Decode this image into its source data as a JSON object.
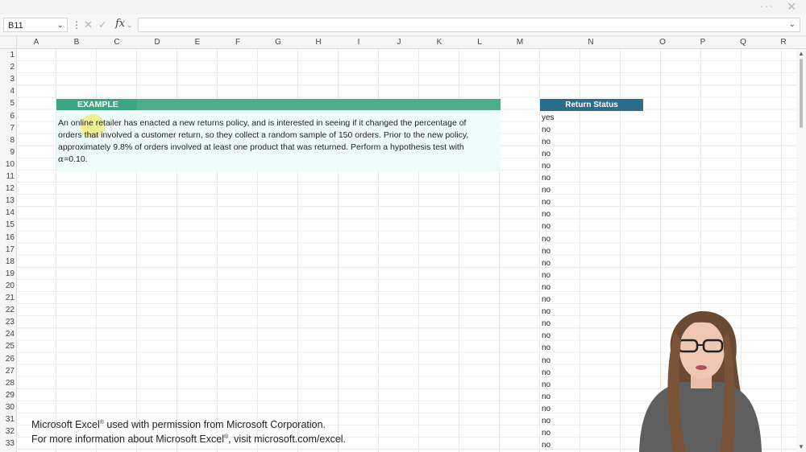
{
  "window": {
    "more_icon": "more-icon",
    "close_icon": "close-icon"
  },
  "formula_bar": {
    "name_box": "B11",
    "fx_label": "fx",
    "formula_value": ""
  },
  "columns": [
    "A",
    "B",
    "C",
    "D",
    "E",
    "F",
    "G",
    "H",
    "I",
    "J",
    "K",
    "L",
    "M",
    "N",
    "O",
    "P",
    "Q",
    "R"
  ],
  "rows": [
    "1",
    "2",
    "3",
    "4",
    "5",
    "6",
    "7",
    "8",
    "9",
    "10",
    "11",
    "12",
    "13",
    "14",
    "15",
    "16",
    "17",
    "18",
    "19",
    "20",
    "21",
    "22",
    "23",
    "24",
    "25",
    "26",
    "27",
    "28",
    "29",
    "30",
    "31",
    "32",
    "33"
  ],
  "example": {
    "title": "EXAMPLE",
    "line1": "An online retailer has enacted a new returns policy, and is interested in seeing if it changed the percentage of",
    "line2": "orders that involved a customer return, so they collect a random sample of 150 orders. Prior to the new policy,",
    "line3": "approximately 9.8% of orders involved at least one product that was returned. Perform a hypothesis test with",
    "alpha_symbol": "α",
    "alpha_value": "=0.10."
  },
  "return_status": {
    "header": "Return Status",
    "values": [
      "yes",
      "no",
      "no",
      "no",
      "no",
      "no",
      "no",
      "no",
      "no",
      "no",
      "no",
      "no",
      "no",
      "no",
      "no",
      "no",
      "no",
      "no",
      "no",
      "no",
      "no",
      "no",
      "no",
      "no",
      "no",
      "no",
      "no",
      "no"
    ]
  },
  "permission": {
    "line1_a": "Microsoft Excel",
    "line1_reg": "®",
    "line1_b": " used with permission from Microsoft Corporation.",
    "line2_a": "For more information about Microsoft Excel",
    "line2_reg": "®",
    "line2_b": ", visit microsoft.com/excel."
  },
  "colors": {
    "example_green": "#3aa684",
    "status_blue": "#2a6d8c",
    "example_bg": "#eefcfb"
  }
}
